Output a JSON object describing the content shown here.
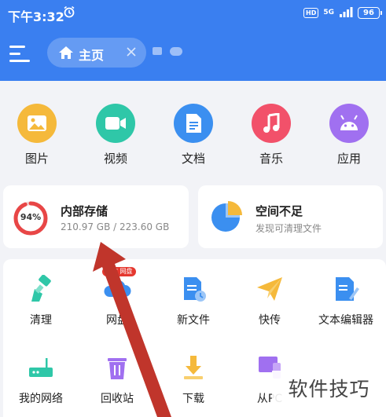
{
  "status_bar": {
    "time": "下午3:32",
    "hd": "HD",
    "network": "5G",
    "battery": "96"
  },
  "header": {
    "home_tab_label": "主页"
  },
  "categories": [
    {
      "label": "图片",
      "color": "#f5b93b",
      "icon": "image-icon"
    },
    {
      "label": "视频",
      "color": "#2fc7a8",
      "icon": "video-icon"
    },
    {
      "label": "文档",
      "color": "#3b8ff0",
      "icon": "document-icon"
    },
    {
      "label": "音乐",
      "color": "#f2516a",
      "icon": "music-icon"
    },
    {
      "label": "应用",
      "color": "#a070f0",
      "icon": "android-icon"
    }
  ],
  "storage": {
    "percent": "94%",
    "percent_value": 0.94,
    "title": "内部存储",
    "usage": "210.97 GB / 223.60 GB",
    "ring_color": "#e84646"
  },
  "space": {
    "title": "空间不足",
    "subtitle": "发现可清理文件"
  },
  "tools": [
    {
      "label": "清理",
      "icon": "broom-icon"
    },
    {
      "label": "网盘",
      "icon": "cloud-drive-icon",
      "badge": "百度 网盘"
    },
    {
      "label": "新文件",
      "icon": "new-file-icon"
    },
    {
      "label": "快传",
      "icon": "paper-plane-icon"
    },
    {
      "label": "文本编辑器",
      "icon": "text-editor-icon"
    },
    {
      "label": "我的网络",
      "icon": "router-icon"
    },
    {
      "label": "回收站",
      "icon": "trash-icon"
    },
    {
      "label": "下载",
      "icon": "download-icon"
    },
    {
      "label": "从PC",
      "icon": "pc-transfer-icon"
    }
  ],
  "watermark": "软件技巧"
}
